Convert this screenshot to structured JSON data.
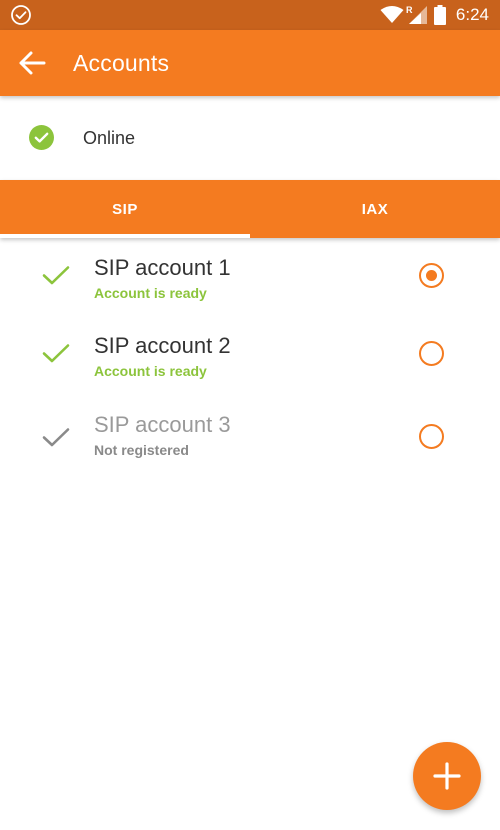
{
  "status_bar": {
    "time": "6:24",
    "roaming_indicator": "R",
    "icons": [
      "check-circle-icon",
      "wifi-icon",
      "signal-icon",
      "battery-icon"
    ]
  },
  "app_bar": {
    "title": "Accounts",
    "back_icon": "arrow-back-icon"
  },
  "presence": {
    "label": "Online",
    "icon": "check-circle-icon",
    "color": "#8cc43c"
  },
  "tabs": [
    {
      "label": "SIP",
      "selected": true
    },
    {
      "label": "IAX",
      "selected": false
    }
  ],
  "accounts": [
    {
      "name": "SIP account 1",
      "status": "Account is ready",
      "state": "ready",
      "selected": true
    },
    {
      "name": "SIP account 2",
      "status": "Account is ready",
      "state": "ready",
      "selected": false
    },
    {
      "name": "SIP account 3",
      "status": "Not registered",
      "state": "unregistered",
      "selected": false
    }
  ],
  "fab": {
    "icon": "plus-icon"
  },
  "colors": {
    "accent": "#f47b20",
    "status_bar": "#c8621c",
    "ready": "#8cc43c",
    "unregistered": "#8a8a8a"
  }
}
